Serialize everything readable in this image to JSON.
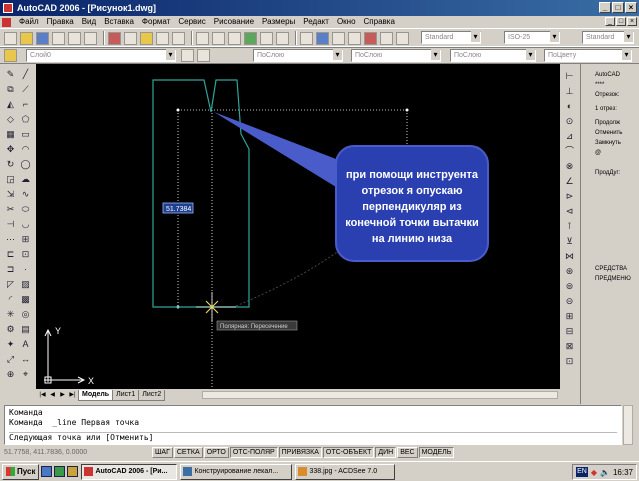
{
  "window": {
    "title": "AutoCAD 2006 - [Рисунок1.dwg]"
  },
  "menu": [
    "Файл",
    "Правка",
    "Вид",
    "Вставка",
    "Формат",
    "Сервис",
    "Рисование",
    "Размеры",
    "Редакт",
    "Окно",
    "Справка"
  ],
  "toolbar": {
    "text_style": "Standard",
    "dim_style": "ISO-25",
    "table_style": "Standard",
    "layer": "Слой0",
    "color": "ПоСлою",
    "linetype": "ПоСлою",
    "lineweight": "ПоСлою",
    "plot_style": "ПоЦвету"
  },
  "drawing": {
    "dynamic_input_value": "51.7384",
    "tooltip": "Полярная: Пересечение",
    "callout": "при помощи инструента отрезок я опускаю перпендикуляр из конечной точки вытачки на линию низа",
    "ucs_x": "X",
    "ucs_y": "Y"
  },
  "tabs": [
    "Модель",
    "Лист1",
    "Лист2"
  ],
  "palette": {
    "lines": [
      "AutoCAD",
      "****",
      "Отрезок:",
      "1 отрез:",
      "Продолж",
      "Отменить",
      "Замкнуть",
      "@",
      "ПродДуг:",
      "СРЕДСТВА",
      "ПРЕДМЕНЮ"
    ]
  },
  "command_line": [
    "Команда",
    "Команда  _line Первая точка",
    "Следующая точка или [Отменить]"
  ],
  "status": {
    "coords": "51.7758, 411.7836, 0.0000",
    "buttons": [
      "ШАГ",
      "СЕТКА",
      "ОРТО",
      "ОТС-ПОЛЯР",
      "ПРИВЯЗКА",
      "ОТС-ОБЪЕКТ",
      "ДИН",
      "ВЕС",
      "МОДЕЛЬ"
    ],
    "active": [
      "ОТС-ПОЛЯР",
      "ПРИВЯЗКА",
      "ОТС-ОБЪЕКТ",
      "ДИН",
      "МОДЕЛЬ"
    ]
  },
  "taskbar": {
    "start": "Пуск",
    "tasks": [
      "AutoCAD 2006 - [Ри...",
      "Конструирование лекал...",
      "338.jpg - ACDSee 7.0"
    ],
    "lang": "EN",
    "clock": "16:37"
  },
  "colors": {
    "outline": "#2fa59a",
    "callout_bg": "#2a3fb0",
    "callout_pointer": "#4a5cc9",
    "tracking": "#ffffff"
  }
}
